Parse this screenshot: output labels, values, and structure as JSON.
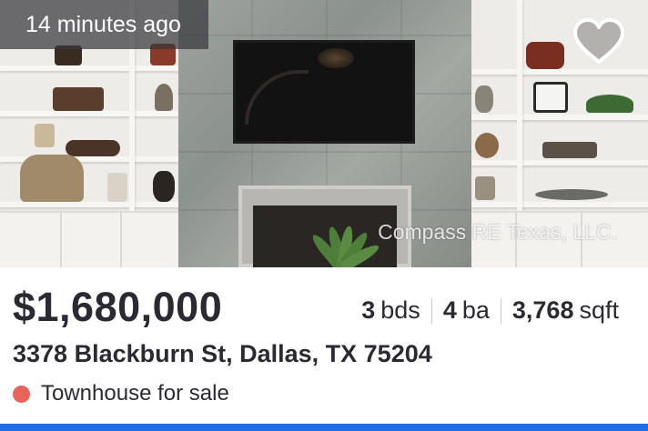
{
  "listing": {
    "posted_ago": "14 minutes ago",
    "favorite_icon": "heart-outline-icon",
    "photo_credit": "Compass RE Texas, LLC.",
    "price": "$1,680,000",
    "beds_value": "3",
    "beds_unit": "bds",
    "baths_value": "4",
    "baths_unit": "ba",
    "sqft_value": "3,768",
    "sqft_unit": "sqft",
    "address": "3378 Blackburn St, Dallas, TX 75204",
    "status_text": "Townhouse for sale",
    "status_icon": "status-dot-icon"
  },
  "colors": {
    "status_dot": "#e8645a",
    "bottom_bar": "#1f6fe5",
    "text": "#2a2a33"
  }
}
